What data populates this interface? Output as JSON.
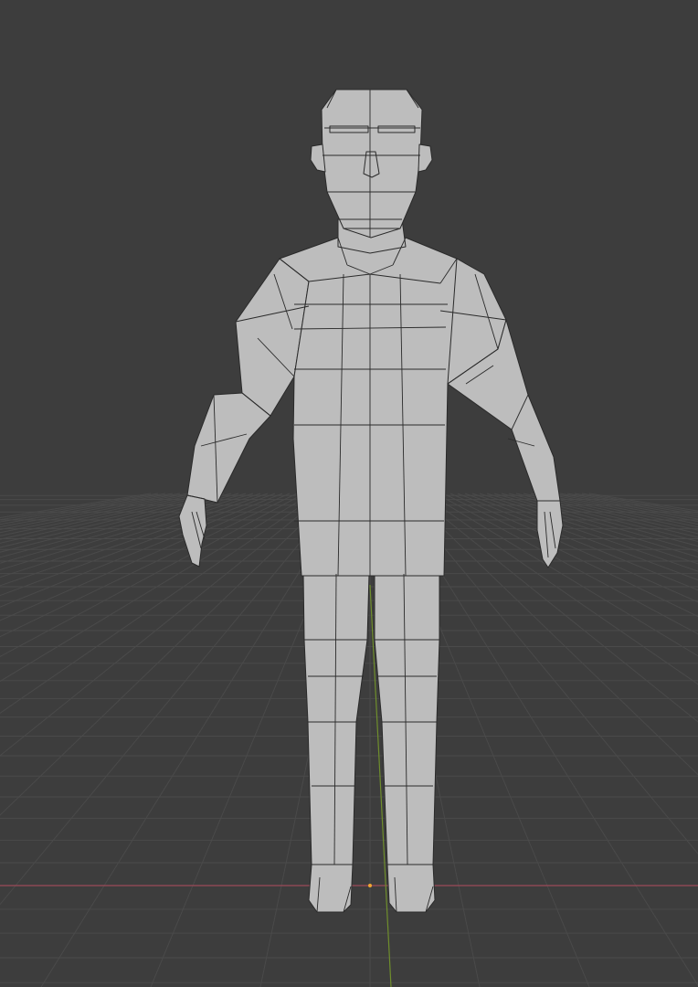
{
  "viewport": {
    "background": "#3d3d3d",
    "grid_color": "#4a4a4a",
    "x_axis_color": "#9b4a58",
    "y_axis_color": "#6f8e2c",
    "origin_color": "#f2a533",
    "mesh_color": "#bdbdbd",
    "mesh_wire_color": "#2a2a2a"
  },
  "scene": {
    "object": "low-poly-humanoid-mesh",
    "pose": "A-pose",
    "shading": "solid"
  }
}
